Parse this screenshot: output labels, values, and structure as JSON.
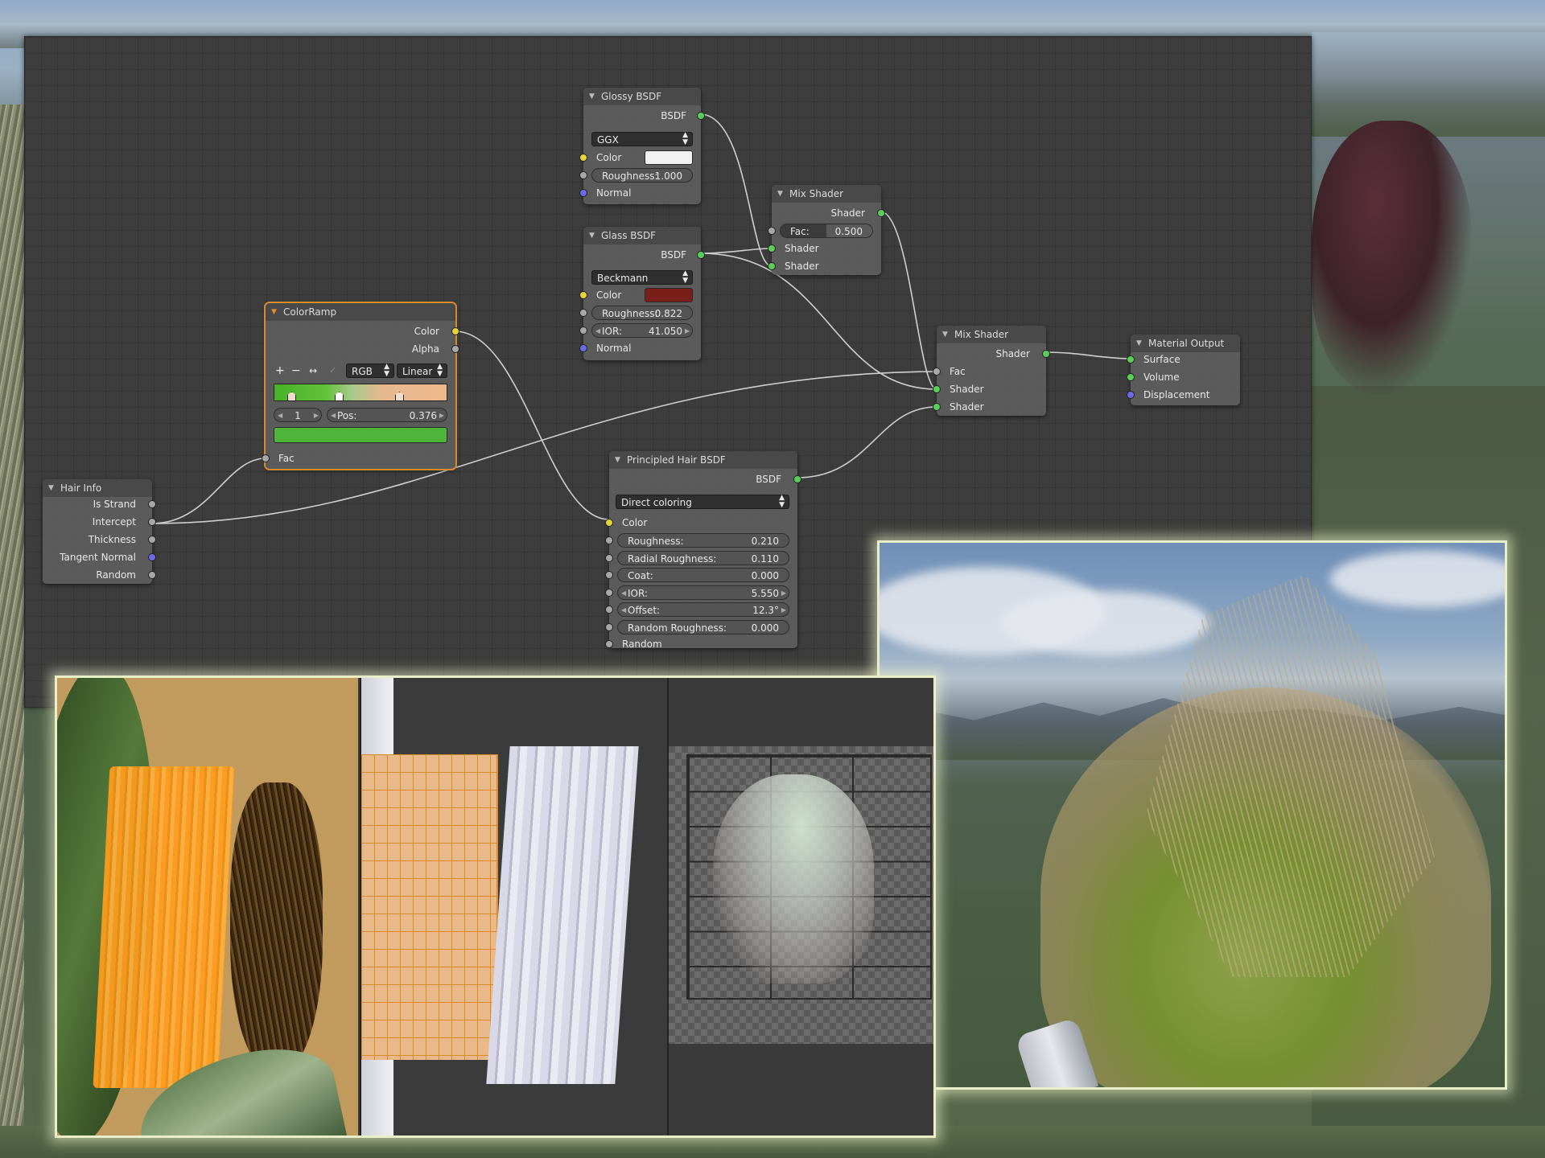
{
  "nodes": {
    "glossy": {
      "title": "Glossy BSDF",
      "output": "BSDF",
      "distribution": "GGX",
      "color_label": "Color",
      "color_value": "#f1f1f1",
      "roughness_label": "Roughness:",
      "roughness_value": "1.000",
      "normal_label": "Normal"
    },
    "glass": {
      "title": "Glass BSDF",
      "output": "BSDF",
      "distribution": "Beckmann",
      "color_label": "Color",
      "color_value": "#7a1f18",
      "roughness_label": "Roughness:",
      "roughness_value": "0.822",
      "ior_label": "IOR:",
      "ior_value": "41.050",
      "normal_label": "Normal"
    },
    "mix1": {
      "title": "Mix Shader",
      "output": "Shader",
      "fac_label": "Fac:",
      "fac_value": "0.500",
      "in1": "Shader",
      "in2": "Shader"
    },
    "mix2": {
      "title": "Mix Shader",
      "output": "Shader",
      "fac_label": "Fac",
      "in1": "Shader",
      "in2": "Shader"
    },
    "output": {
      "title": "Material Output",
      "surface": "Surface",
      "volume": "Volume",
      "displacement": "Displacement"
    },
    "colorramp": {
      "title": "ColorRamp",
      "out_color": "Color",
      "out_alpha": "Alpha",
      "btn_add": "+",
      "btn_remove": "−",
      "btn_flip": "↔",
      "btn_eyedrop": "✓",
      "color_mode": "RGB",
      "interpolation": "Linear",
      "stop_index": "1",
      "pos_label": "Pos:",
      "pos_value": "0.376",
      "active_color": "#4cb53a",
      "fac_label": "Fac"
    },
    "hairinfo": {
      "title": "Hair Info",
      "outputs": [
        "Is Strand",
        "Intercept",
        "Thickness",
        "Tangent Normal",
        "Random"
      ]
    },
    "hair": {
      "title": "Principled Hair BSDF",
      "output": "BSDF",
      "parametrization": "Direct coloring",
      "color_label": "Color",
      "fields": [
        {
          "label": "Roughness:",
          "value": "0.210"
        },
        {
          "label": "Radial Roughness:",
          "value": "0.110"
        },
        {
          "label": "Coat:",
          "value": "0.000"
        },
        {
          "label": "IOR:",
          "value": "5.550"
        },
        {
          "label": "Offset:",
          "value": "12.3°"
        },
        {
          "label": "Random Roughness:",
          "value": "0.000"
        }
      ],
      "random_label": "Random"
    }
  },
  "colors": {
    "socket_shader": "#58d058",
    "socket_color": "#e3d43a",
    "socket_value": "#a8a8a8",
    "socket_vector": "#6a6ae8",
    "selection": "#d98a2b",
    "editor_bg": "#3d3d3d"
  }
}
